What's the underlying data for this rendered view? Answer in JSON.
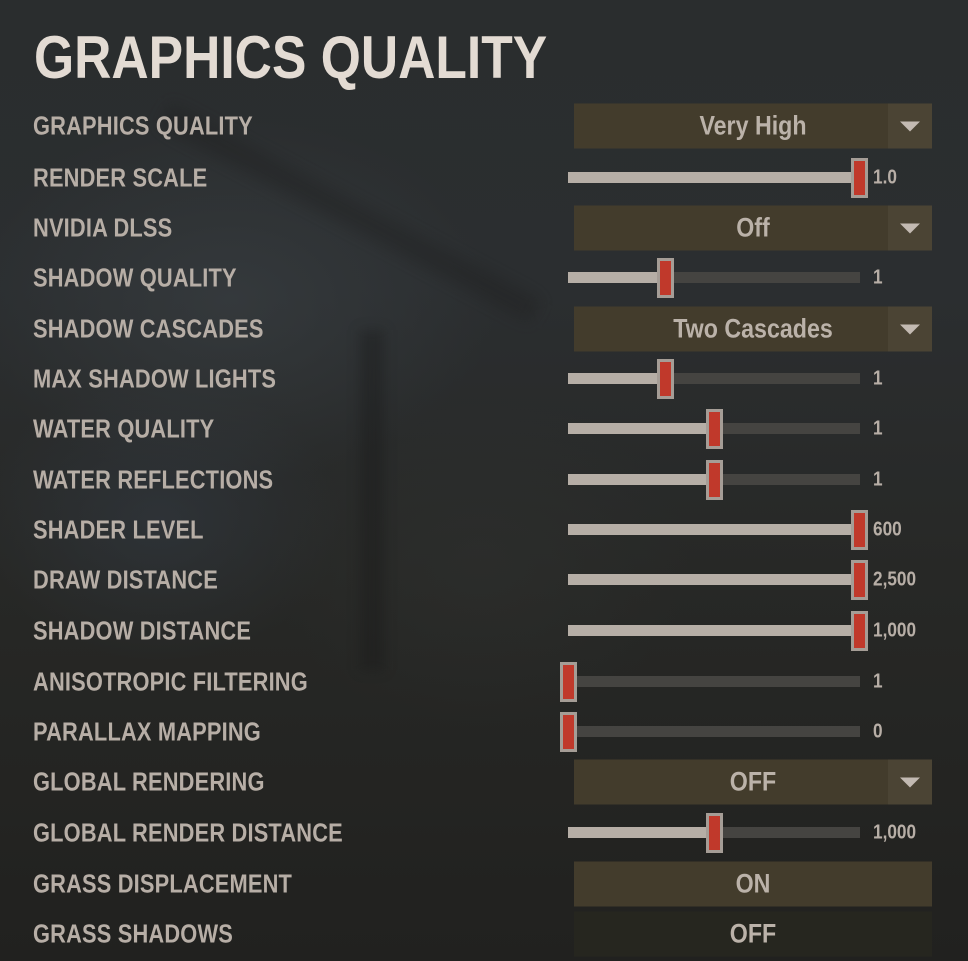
{
  "page_title": "GRAPHICS QUALITY",
  "colors": {
    "accent_thumb": "#c0392b",
    "dropdown_bg": "#433c2c",
    "track_filled": "#b6aea6",
    "track_empty": "#454441",
    "label_text": "#b7aea6"
  },
  "settings": [
    {
      "label": "GRAPHICS QUALITY",
      "type": "dropdown",
      "value": "Very High",
      "icon": "chevron-down-icon"
    },
    {
      "label": "RENDER SCALE",
      "type": "slider",
      "value": "1.0",
      "fraction": 1.0
    },
    {
      "label": "NVIDIA DLSS",
      "type": "dropdown",
      "value": "Off",
      "icon": "chevron-down-icon"
    },
    {
      "label": "SHADOW QUALITY",
      "type": "slider",
      "value": "1",
      "fraction": 0.333
    },
    {
      "label": "SHADOW CASCADES",
      "type": "dropdown",
      "value": "Two Cascades",
      "icon": "chevron-down-icon"
    },
    {
      "label": "MAX SHADOW LIGHTS",
      "type": "slider",
      "value": "1",
      "fraction": 0.333
    },
    {
      "label": "WATER QUALITY",
      "type": "slider",
      "value": "1",
      "fraction": 0.5
    },
    {
      "label": "WATER REFLECTIONS",
      "type": "slider",
      "value": "1",
      "fraction": 0.5
    },
    {
      "label": "SHADER LEVEL",
      "type": "slider",
      "value": "600",
      "fraction": 1.0
    },
    {
      "label": "DRAW DISTANCE",
      "type": "slider",
      "value": "2,500",
      "fraction": 1.0
    },
    {
      "label": "SHADOW DISTANCE",
      "type": "slider",
      "value": "1,000",
      "fraction": 1.0
    },
    {
      "label": "ANISOTROPIC FILTERING",
      "type": "slider",
      "value": "1",
      "fraction": 0.0
    },
    {
      "label": "PARALLAX MAPPING",
      "type": "slider",
      "value": "0",
      "fraction": 0.0
    },
    {
      "label": "GLOBAL RENDERING",
      "type": "dropdown",
      "value": "OFF",
      "icon": "chevron-down-icon"
    },
    {
      "label": "GLOBAL RENDER DISTANCE",
      "type": "slider",
      "value": "1,000",
      "fraction": 0.5
    },
    {
      "label": "GRASS DISPLACEMENT",
      "type": "toggle",
      "value": "ON",
      "state": "on"
    },
    {
      "label": "GRASS SHADOWS",
      "type": "toggle",
      "value": "OFF",
      "state": "off"
    }
  ]
}
